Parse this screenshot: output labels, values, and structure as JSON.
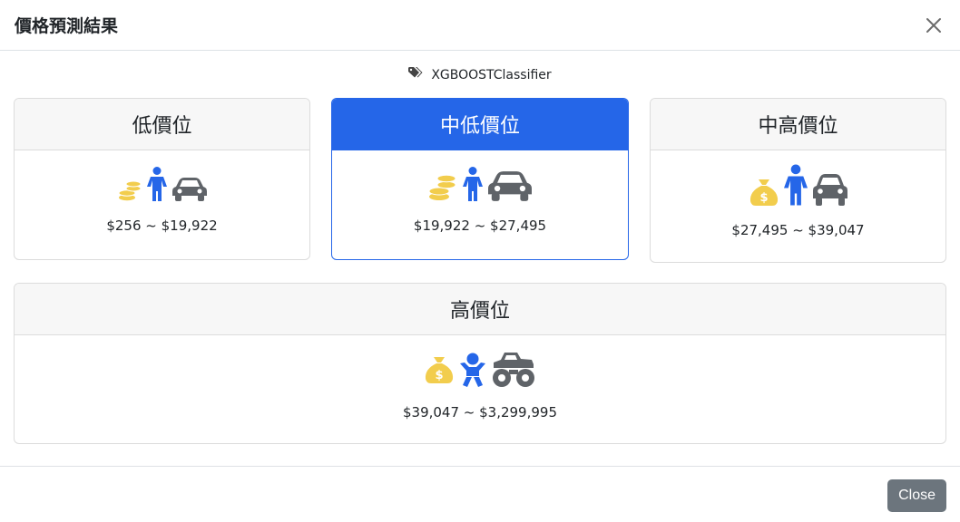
{
  "modal": {
    "title": "價格預測結果",
    "close_label": "Close"
  },
  "model": {
    "icon": "tags-icon",
    "name": "XGBOOSTClassifier"
  },
  "colors": {
    "accent": "#2566e8",
    "coin": "#f2cd4d",
    "person": "#2566e8",
    "vehicle": "#5f6368"
  },
  "tiers": [
    {
      "label": "低價位",
      "range": "$256 ~ $19,922",
      "active": false,
      "icons": [
        "coins-icon",
        "person-icon",
        "car-icon"
      ]
    },
    {
      "label": "中低價位",
      "range": "$19,922 ~ $27,495",
      "active": true,
      "icons": [
        "coins-icon",
        "person-icon",
        "car-icon"
      ]
    },
    {
      "label": "中高價位",
      "range": "$27,495 ~ $39,047",
      "active": false,
      "icons": [
        "money-bag-icon",
        "person-icon",
        "car-icon"
      ]
    },
    {
      "label": "高價位",
      "range": "$39,047 ~ $3,299,995",
      "active": false,
      "icons": [
        "money-bag-icon",
        "baby-icon",
        "monster-truck-icon"
      ]
    }
  ]
}
